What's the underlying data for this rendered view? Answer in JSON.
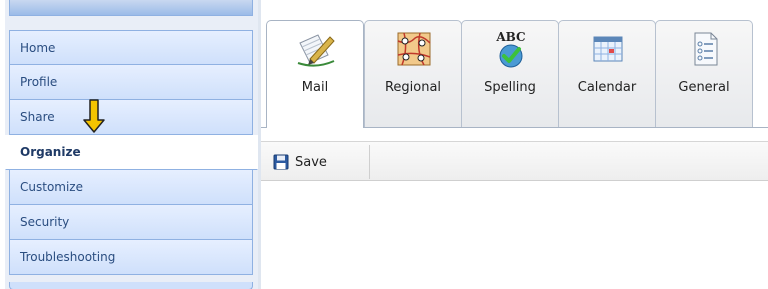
{
  "nav": {
    "items": [
      {
        "label": "Home"
      },
      {
        "label": "Profile"
      },
      {
        "label": "Share"
      },
      {
        "label": "Organize"
      },
      {
        "label": "Customize"
      },
      {
        "label": "Security"
      },
      {
        "label": "Troubleshooting"
      }
    ],
    "selected": "Organize",
    "indicator_icon": "down-arrow-icon"
  },
  "tabs": [
    {
      "label": "Mail",
      "icon": "mail-writing-icon",
      "active": true
    },
    {
      "label": "Regional",
      "icon": "regional-map-icon",
      "active": false
    },
    {
      "label": "Spelling",
      "icon": "abc-check-icon",
      "active": false
    },
    {
      "label": "Calendar",
      "icon": "calendar-icon",
      "active": false
    },
    {
      "label": "General",
      "icon": "general-list-icon",
      "active": false
    }
  ],
  "toolbar": {
    "save_label": "Save",
    "save_icon": "floppy-disk-icon"
  },
  "colors": {
    "nav_border": "#8fb1e2",
    "nav_item_bg": "#cfe0fb",
    "nav_text": "#2a4d80",
    "arrow_fill": "#f5c400"
  }
}
